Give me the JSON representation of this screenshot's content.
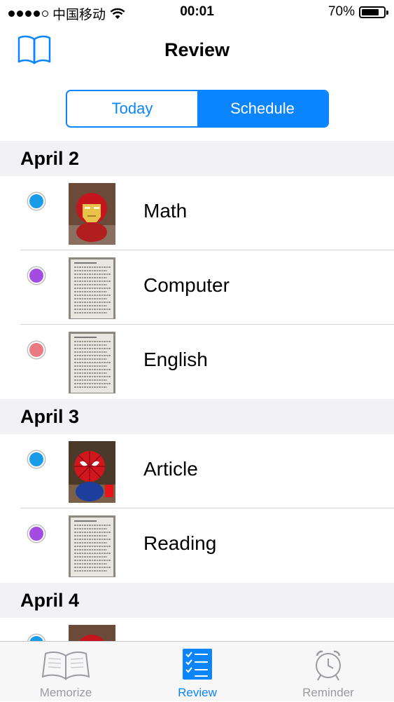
{
  "status_bar": {
    "carrier": "中国移动",
    "time": "00:01",
    "battery": "70%"
  },
  "nav": {
    "title": "Review",
    "left_icon": "book-icon"
  },
  "segment": {
    "options": [
      "Today",
      "Schedule"
    ],
    "selected": "Schedule"
  },
  "sections": [
    {
      "date": "April 2",
      "items": [
        {
          "name": "Math",
          "color": "#1a9be8",
          "thumb": "ironman"
        },
        {
          "name": "Computer",
          "color": "#a44be4",
          "thumb": "document"
        },
        {
          "name": "English",
          "color": "#ea7a82",
          "thumb": "document"
        }
      ]
    },
    {
      "date": "April 3",
      "items": [
        {
          "name": "Article",
          "color": "#1a9be8",
          "thumb": "spiderman"
        },
        {
          "name": "Reading",
          "color": "#a44be4",
          "thumb": "document"
        }
      ]
    },
    {
      "date": "April 4",
      "items": [
        {
          "name": "",
          "color": "#1a9be8",
          "thumb": "ironman"
        }
      ]
    }
  ],
  "tabs": [
    {
      "label": "Memorize",
      "icon": "open-book-icon"
    },
    {
      "label": "Review",
      "icon": "checklist-icon",
      "active": true
    },
    {
      "label": "Reminder",
      "icon": "alarm-clock-icon"
    }
  ],
  "colors": {
    "accent": "#0a84ff"
  }
}
